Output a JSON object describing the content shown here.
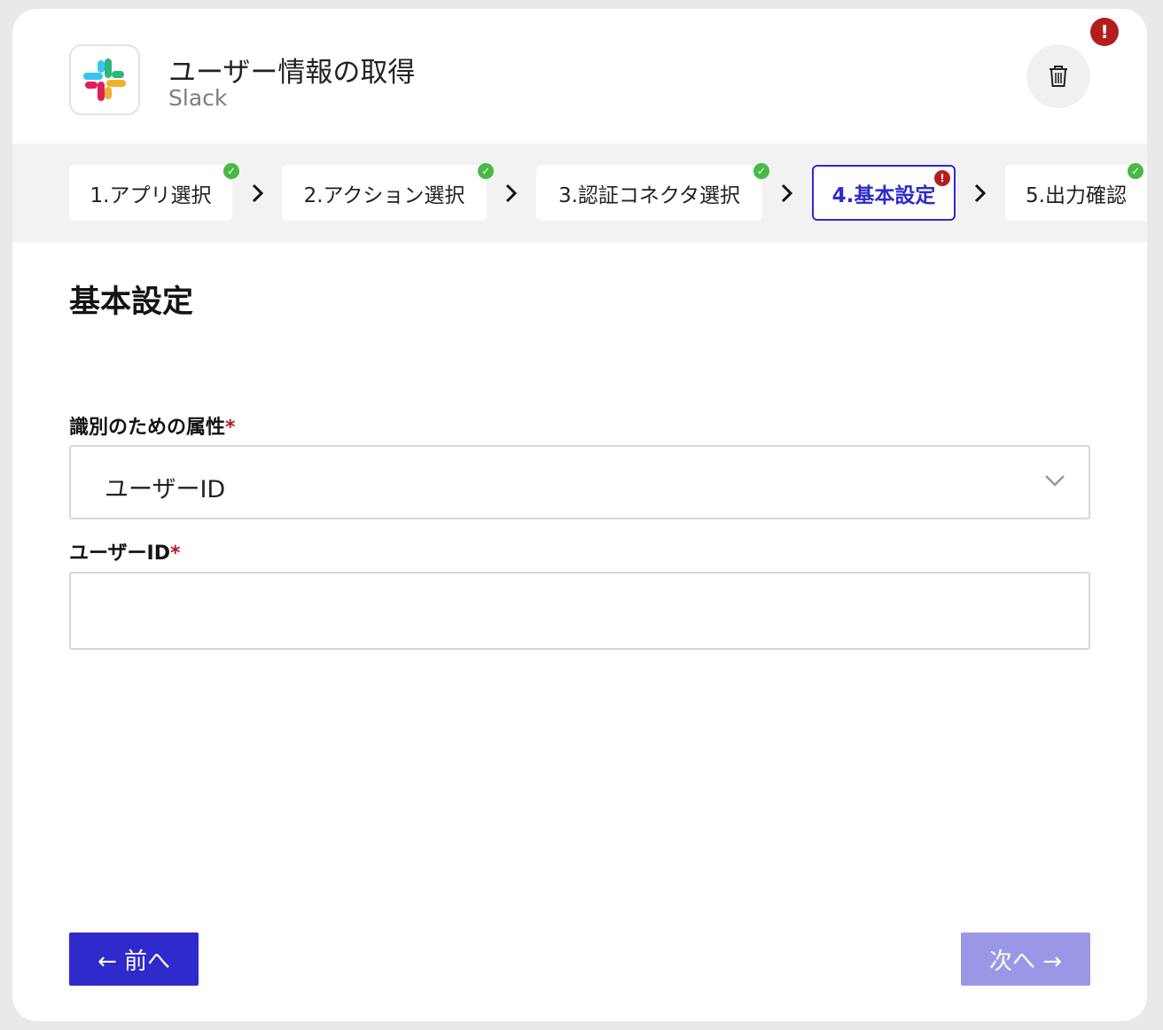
{
  "header": {
    "title": "ユーザー情報の取得",
    "app_name": "Slack",
    "logo_icon": "slack-logo",
    "delete_icon": "trash-icon",
    "error_badge": "!"
  },
  "steps": [
    {
      "label": "1.アプリ選択",
      "status": "complete"
    },
    {
      "label": "2.アクション選択",
      "status": "complete"
    },
    {
      "label": "3.認証コネクタ選択",
      "status": "complete"
    },
    {
      "label": "4.基本設定",
      "status": "error",
      "active": true
    },
    {
      "label": "5.出力確認",
      "status": "complete"
    }
  ],
  "step_badges": {
    "complete": "✓",
    "error": "!"
  },
  "main": {
    "section_title": "基本設定",
    "attr_field": {
      "label": "識別のための属性",
      "required_mark": "*",
      "selected": "ユーザーID"
    },
    "user_id_field": {
      "label": "ユーザーID",
      "required_mark": "*",
      "value": "",
      "placeholder": ""
    }
  },
  "footer": {
    "prev_label": "← 前へ",
    "next_label": "次へ →"
  },
  "colors": {
    "accent": "#2e2acc",
    "accent_disabled": "#9a98e6",
    "error": "#b21e1e",
    "success": "#46b946"
  }
}
